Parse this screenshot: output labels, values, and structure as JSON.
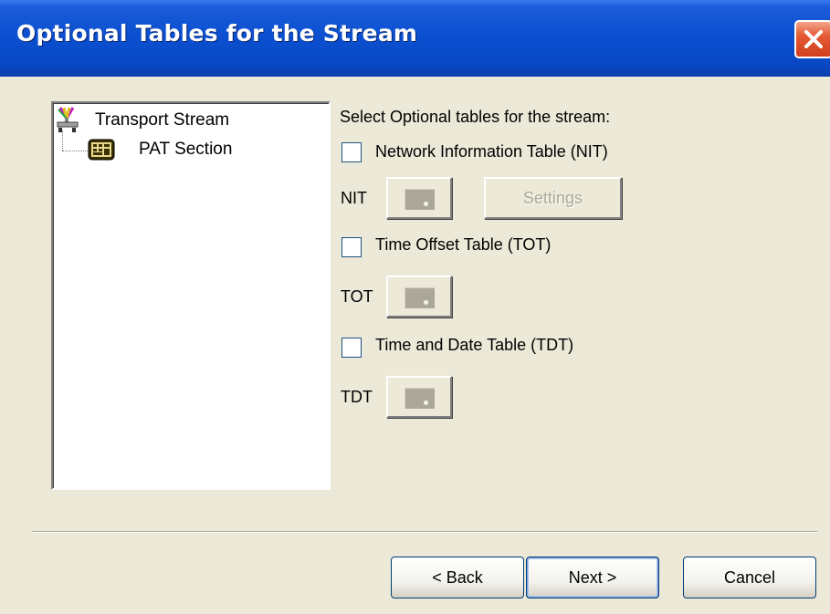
{
  "window": {
    "title": "Optional Tables for the Stream"
  },
  "tree": {
    "root": {
      "label": "Transport Stream",
      "icon": "network-icon"
    },
    "child": {
      "label": "PAT Section",
      "icon": "table-section-icon"
    }
  },
  "options": {
    "prompt": "Select Optional tables for the stream:",
    "nit": {
      "label": "Network Information Table (NIT)",
      "checked": false,
      "row_label": "NIT",
      "settings_label": "Settings"
    },
    "tot": {
      "label": "Time Offset Table (TOT)",
      "checked": false,
      "row_label": "TOT"
    },
    "tdt": {
      "label": "Time and Date Table (TDT)",
      "checked": false,
      "row_label": "TDT"
    }
  },
  "buttons": {
    "back": "< Back",
    "next": "Next >",
    "cancel": "Cancel"
  },
  "colors": {
    "titlebar": "#0a4fd0",
    "face": "#ece9d8",
    "close": "#e45a33"
  }
}
